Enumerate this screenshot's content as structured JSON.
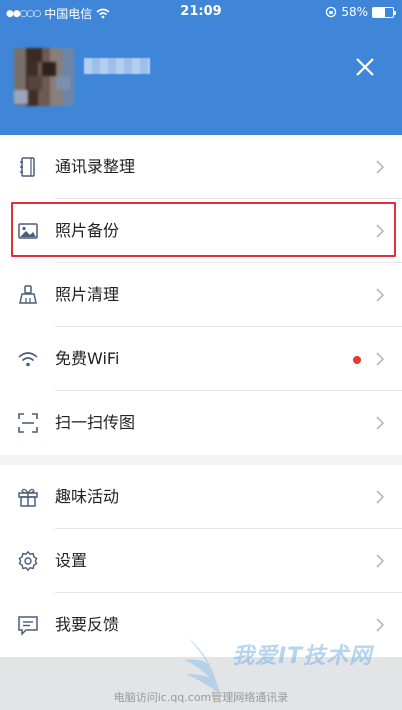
{
  "status_bar": {
    "signal": "●●○○○",
    "carrier": "中国电信",
    "time": "21:09",
    "battery": "58%",
    "battery_level": 0.58
  },
  "menu_group_1": [
    {
      "label": "通讯录整理",
      "icon": "contacts-book-icon"
    },
    {
      "label": "照片备份",
      "icon": "photo-icon"
    },
    {
      "label": "照片清理",
      "icon": "broom-icon"
    },
    {
      "label": "免费WiFi",
      "icon": "wifi-icon",
      "badge": "red-dot"
    },
    {
      "label": "扫一扫传图",
      "icon": "scan-icon"
    }
  ],
  "menu_group_2": [
    {
      "label": "趣味活动",
      "icon": "gift-icon"
    },
    {
      "label": "设置",
      "icon": "settings-gear-icon"
    },
    {
      "label": "我要反馈",
      "icon": "feedback-icon"
    }
  ],
  "footer": {
    "text": "电脑访问ic.qq.com管理网络通讯录"
  },
  "watermark": {
    "text": "我爱IT技术网"
  },
  "colors": {
    "header": "#3f86d9",
    "highlight": "#e0303a",
    "badge": "#e8392f"
  }
}
